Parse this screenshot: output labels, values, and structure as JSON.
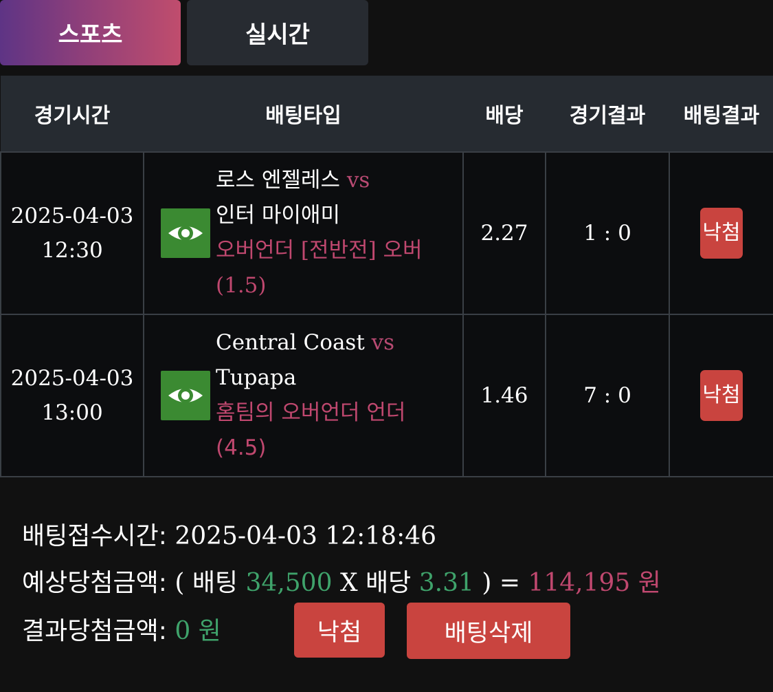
{
  "tabs": {
    "sports": "스포츠",
    "live": "실시간"
  },
  "table": {
    "headers": {
      "time": "경기시간",
      "bet_type": "배팅타입",
      "odds": "배당",
      "match_result": "경기결과",
      "bet_result": "배팅결과"
    },
    "rows": [
      {
        "date": "2025-04-03",
        "time": "12:30",
        "home": "로스 엔젤레스",
        "vs": "vs",
        "away": "인터 마이애미",
        "bet_kind": "오버언더 [전반전] 오버 (1.5)",
        "odds": "2.27",
        "score": "1 : 0",
        "result": "낙첨"
      },
      {
        "date": "2025-04-03",
        "time": "13:00",
        "home": "Central Coast",
        "vs": "vs",
        "away": "Tupapa",
        "bet_kind": "홈팀의 오버언더 언더 (4.5)",
        "odds": "1.46",
        "score": "7 : 0",
        "result": "낙첨"
      }
    ],
    "eye_icon": "eye-icon"
  },
  "summary": {
    "bet_time_label": "배팅접수시간:",
    "bet_time_value": "2025-04-03 12:18:46",
    "expected_label": "예상당첨금액:",
    "expected_open": "(",
    "bet_word": "배팅",
    "bet_amount": "34,500",
    "times": "X",
    "odds_word": "배당",
    "total_odds": "3.31",
    "expected_close": ") =",
    "expected_amount": "114,195 원",
    "result_label": "결과당첨금액:",
    "result_amount": "0 원",
    "result_button": "낙첨",
    "delete_button": "배팅삭제"
  },
  "colors": {
    "accent_pink": "#c0486f",
    "accent_green": "#3fa36b",
    "badge_red": "#c9443f",
    "eye_green": "#3b8a32"
  }
}
